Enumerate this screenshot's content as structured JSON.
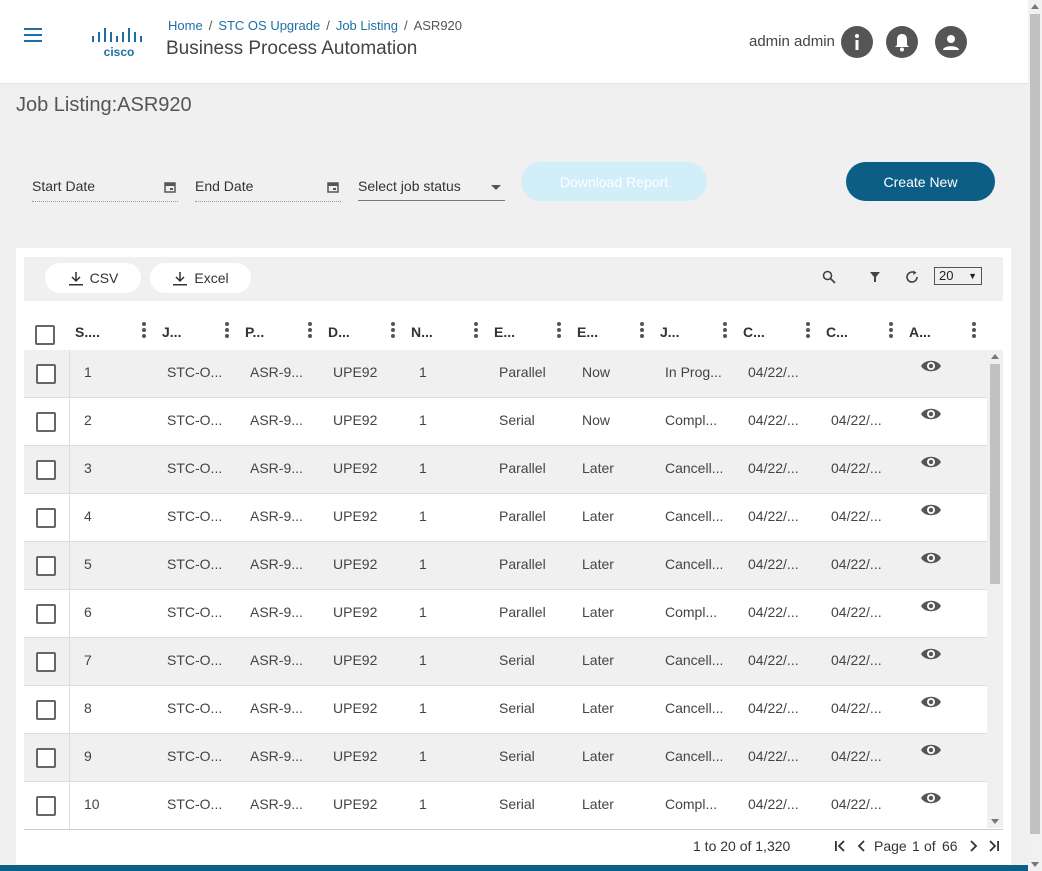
{
  "header": {
    "breadcrumb": [
      "Home",
      "STC OS Upgrade",
      "Job Listing",
      "ASR920"
    ],
    "app_title": "Business Process Automation",
    "user_name": "admin admin",
    "icons": [
      "menu-icon",
      "info-icon",
      "bell-icon",
      "user-icon"
    ]
  },
  "page": {
    "title": "Job Listing:ASR920"
  },
  "filters": {
    "start_date": "Start Date",
    "end_date": "End Date",
    "job_status": "Select job status",
    "download_label": "Download Report",
    "create_label": "Create New"
  },
  "toolbar": {
    "csv_label": "CSV",
    "excel_label": "Excel",
    "page_size": "20"
  },
  "columns": [
    "S....",
    "J...",
    "P...",
    "D...",
    "N...",
    "E...",
    "E...",
    "J...",
    "C...",
    "C...",
    "A..."
  ],
  "rows": [
    [
      "1",
      "STC-O...",
      "ASR-9...",
      "UPE92",
      "1",
      "Parallel",
      "Now",
      "In Prog...",
      "04/22/...",
      ""
    ],
    [
      "2",
      "STC-O...",
      "ASR-9...",
      "UPE92",
      "1",
      "Serial",
      "Now",
      "Compl...",
      "04/22/...",
      "04/22/..."
    ],
    [
      "3",
      "STC-O...",
      "ASR-9...",
      "UPE92",
      "1",
      "Parallel",
      "Later",
      "Cancell...",
      "04/22/...",
      "04/22/..."
    ],
    [
      "4",
      "STC-O...",
      "ASR-9...",
      "UPE92",
      "1",
      "Parallel",
      "Later",
      "Cancell...",
      "04/22/...",
      "04/22/..."
    ],
    [
      "5",
      "STC-O...",
      "ASR-9...",
      "UPE92",
      "1",
      "Parallel",
      "Later",
      "Cancell...",
      "04/22/...",
      "04/22/..."
    ],
    [
      "6",
      "STC-O...",
      "ASR-9...",
      "UPE92",
      "1",
      "Parallel",
      "Later",
      "Compl...",
      "04/22/...",
      "04/22/..."
    ],
    [
      "7",
      "STC-O...",
      "ASR-9...",
      "UPE92",
      "1",
      "Serial",
      "Later",
      "Cancell...",
      "04/22/...",
      "04/22/..."
    ],
    [
      "8",
      "STC-O...",
      "ASR-9...",
      "UPE92",
      "1",
      "Serial",
      "Later",
      "Cancell...",
      "04/22/...",
      "04/22/..."
    ],
    [
      "9",
      "STC-O...",
      "ASR-9...",
      "UPE92",
      "1",
      "Serial",
      "Later",
      "Cancell...",
      "04/22/...",
      "04/22/..."
    ],
    [
      "10",
      "STC-O...",
      "ASR-9...",
      "UPE92",
      "1",
      "Serial",
      "Later",
      "Compl...",
      "04/22/...",
      "04/22/..."
    ]
  ],
  "pager": {
    "summary": "1 to 20 of 1,320",
    "page_label": "Page",
    "current": "1",
    "of_label": "of",
    "total": "66"
  },
  "colors": {
    "primary": "#0d5e86",
    "disabled": "#d2eef8",
    "link": "#1d6fa5"
  }
}
